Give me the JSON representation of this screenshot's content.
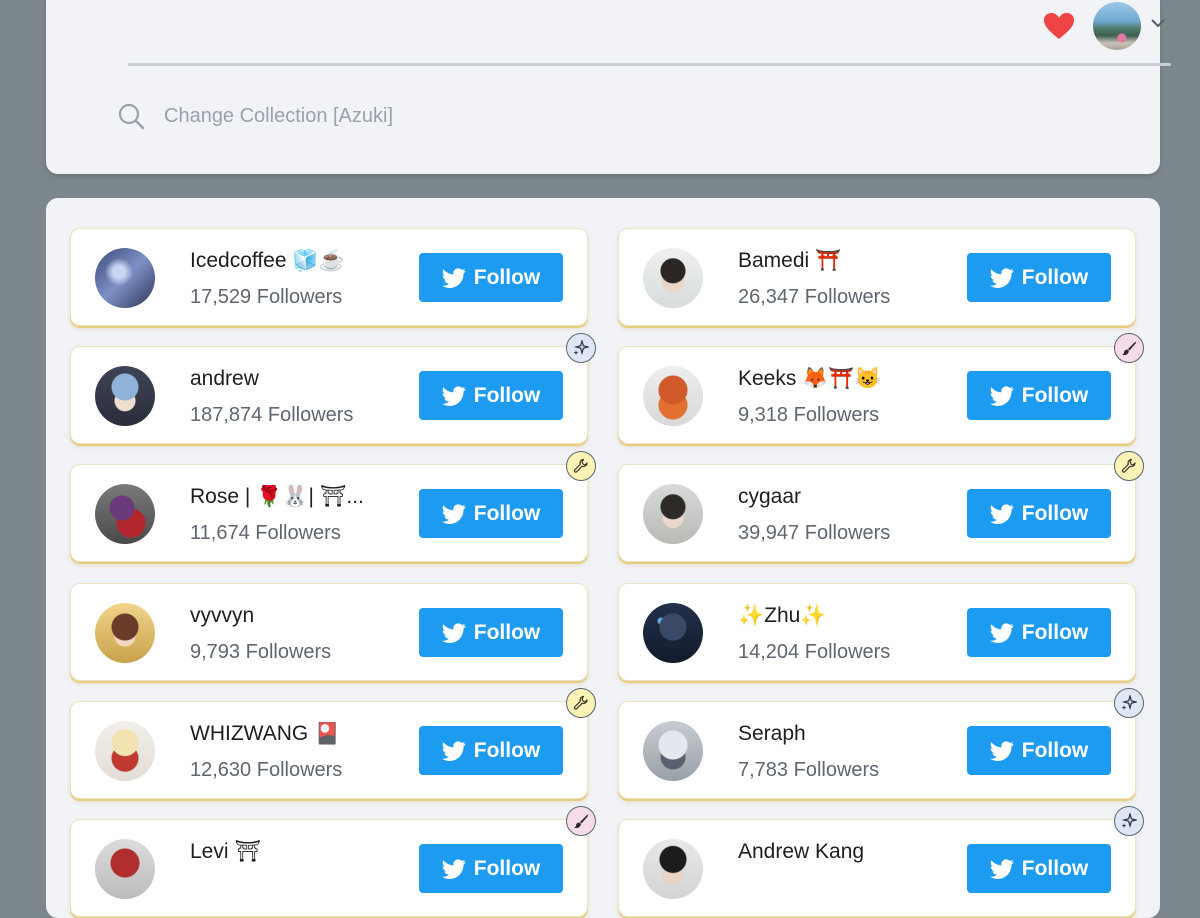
{
  "header": {
    "search_placeholder": "Change Collection [Azuki]",
    "icons": [
      "heart-icon",
      "avatar",
      "chevron-down-icon",
      "search-icon"
    ]
  },
  "colors": {
    "background": "#7b878c",
    "panel": "#f1f3f7",
    "follow_button": "#1d9bf0",
    "card_border": "#e8cd7e",
    "heart": "#ef4444"
  },
  "follow_label": "Follow",
  "cards": [
    {
      "name": "Icedcoffee 🧊☕",
      "followers": "17,529 Followers",
      "badge": "none"
    },
    {
      "name": "Bamedi ⛩️",
      "followers": "26,347 Followers",
      "badge": "none"
    },
    {
      "name": "andrew",
      "followers": "187,874 Followers",
      "badge": "sparkle"
    },
    {
      "name": "Keeks 🦊⛩️😺",
      "followers": "9,318 Followers",
      "badge": "brush"
    },
    {
      "name": "Rose | 🌹🐰| ⛩...",
      "followers": "11,674 Followers",
      "badge": "wrench"
    },
    {
      "name": "cygaar",
      "followers": "39,947 Followers",
      "badge": "wrench"
    },
    {
      "name": "vyvvyn",
      "followers": "9,793 Followers",
      "badge": "none"
    },
    {
      "name": "✨Zhu✨",
      "followers": "14,204 Followers",
      "badge": "none"
    },
    {
      "name": "WHIZWANG 🎴",
      "followers": "12,630 Followers",
      "badge": "wrench"
    },
    {
      "name": "Seraph",
      "followers": "7,783 Followers",
      "badge": "sparkle"
    },
    {
      "name": "Levi ⛩",
      "followers": "",
      "badge": "brush"
    },
    {
      "name": "Andrew Kang",
      "followers": "",
      "badge": "sparkle"
    }
  ]
}
